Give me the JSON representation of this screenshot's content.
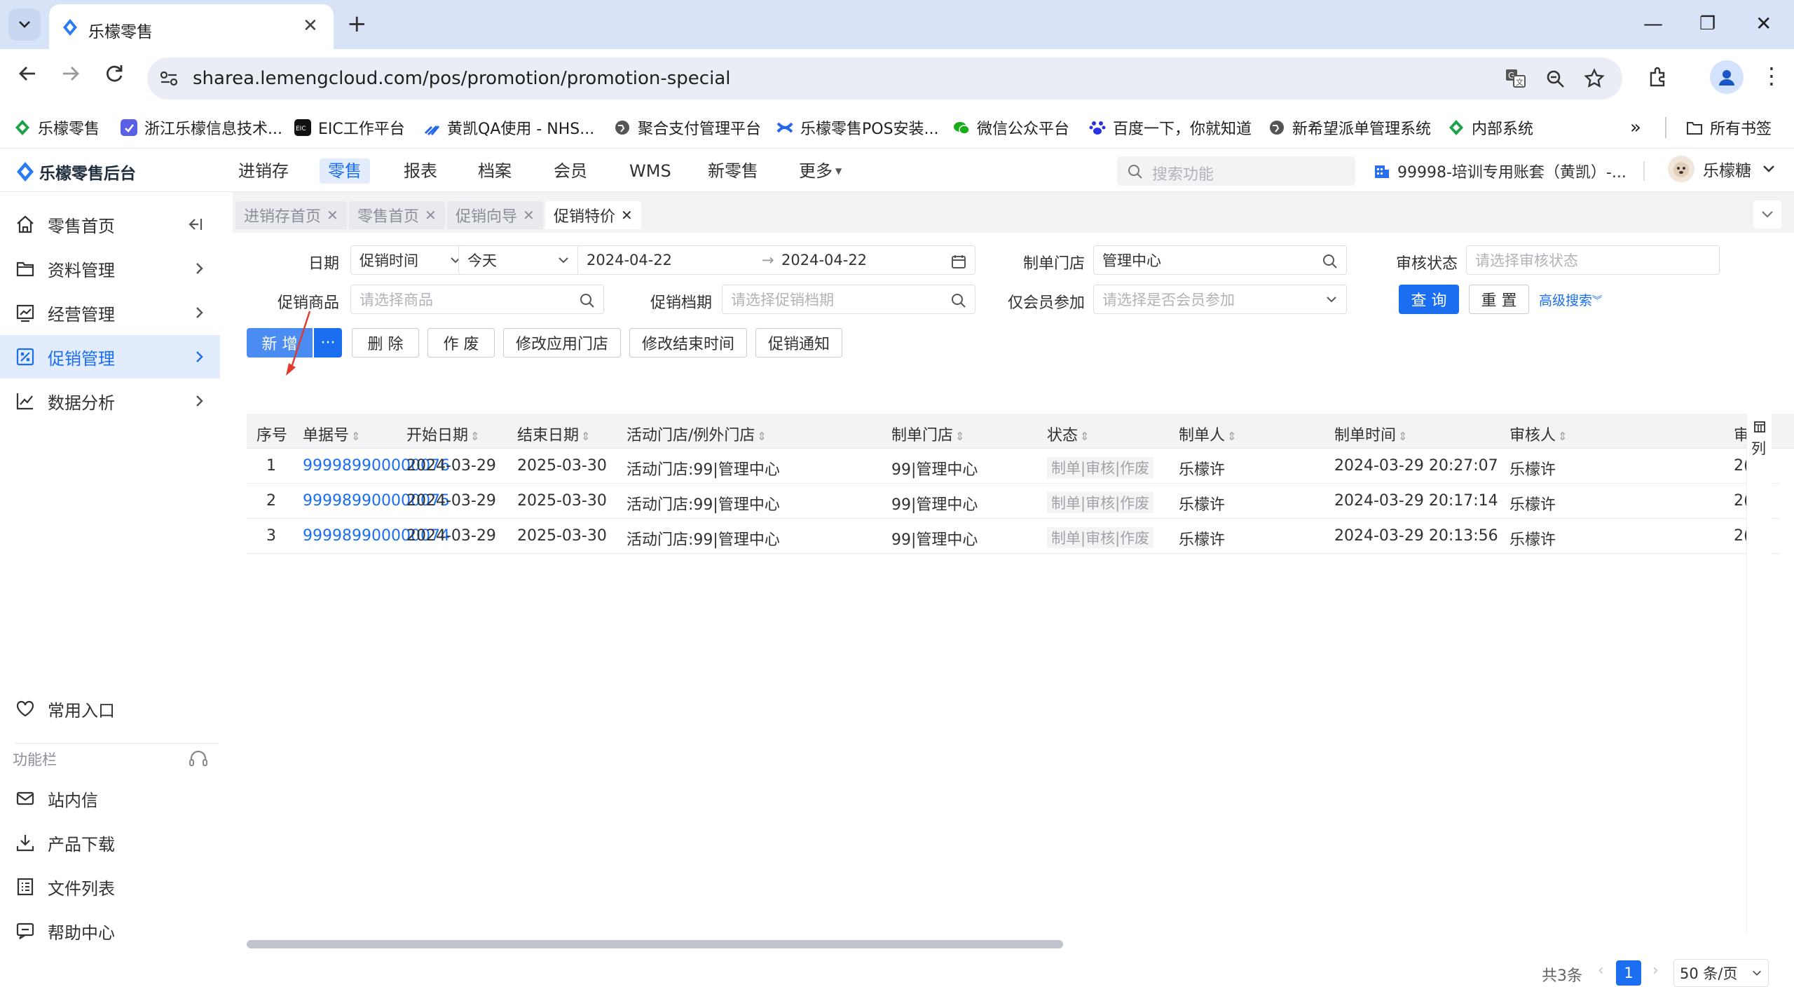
{
  "browser": {
    "tab_title": "乐檬零售",
    "url": "sharea.lemengcloud.com/pos/promotion/promotion-special",
    "bookmarks": [
      "乐檬零售",
      "浙江乐檬信息技术...",
      "EIC工作平台",
      "黄凯QA使用 - NHS...",
      "聚合支付管理平台",
      "乐檬零售POS安装...",
      "微信公众平台",
      "百度一下，你就知道",
      "新希望派单管理系统",
      "内部系统"
    ],
    "all_bookmarks": "所有书签"
  },
  "app": {
    "brand": "乐檬零售后台",
    "nav": [
      "进销存",
      "零售",
      "报表",
      "档案",
      "会员",
      "WMS",
      "新零售",
      "更多"
    ],
    "active_nav": "零售",
    "search_placeholder": "搜索功能",
    "account": "99998-培训专用账套（黄凯）-...",
    "user": "乐檬糖"
  },
  "sidebar": {
    "items": [
      {
        "label": "零售首页",
        "icon": "home-icon"
      },
      {
        "label": "资料管理",
        "icon": "folder-icon"
      },
      {
        "label": "经营管理",
        "icon": "chart-board-icon"
      },
      {
        "label": "促销管理",
        "icon": "promotion-icon"
      },
      {
        "label": "数据分析",
        "icon": "line-chart-icon"
      }
    ],
    "common_entry": "常用入口",
    "func_bar": "功能栏",
    "bottom": [
      "站内信",
      "产品下载",
      "文件列表",
      "帮助中心"
    ]
  },
  "page_tabs": [
    "进销存首页",
    "零售首页",
    "促销向导",
    "促销特价"
  ],
  "filters": {
    "date_label": "日期",
    "date_type": "促销时间",
    "date_range_type": "今天",
    "date_start": "2024-04-22",
    "date_end": "2024-04-22",
    "store_label": "制单门店",
    "store_value": "管理中心",
    "audit_label": "审核状态",
    "audit_placeholder": "请选择审核状态",
    "product_label": "促销商品",
    "product_placeholder": "请选择商品",
    "level_label": "促销档期",
    "level_placeholder": "请选择促销档期",
    "member_label": "仅会员参加",
    "member_placeholder": "请选择是否会员参加",
    "query": "查 询",
    "reset": "重 置",
    "advanced": "高级搜索"
  },
  "actions": {
    "add": "新 增",
    "more": "···",
    "delete": "删 除",
    "void": "作 废",
    "modify_store": "修改应用门店",
    "modify_end": "修改结束时间",
    "notify": "促销通知"
  },
  "table": {
    "columns": [
      "序号",
      "单据号",
      "开始日期",
      "结束日期",
      "活动门店/例外门店",
      "制单门店",
      "状态",
      "制单人",
      "制单时间",
      "审核人",
      "审"
    ],
    "rows": [
      {
        "no": "1",
        "doc": "999989900000076",
        "start": "2024-03-29",
        "end": "2025-03-30",
        "stores": "活动门店:99|管理中心",
        "maker_store": "99|管理中心",
        "status": "制单|审核|作废",
        "maker": "乐檬许",
        "time": "2024-03-29 20:27:07",
        "auditor": "乐檬许",
        "extra": "2("
      },
      {
        "no": "2",
        "doc": "999989900000075",
        "start": "2024-03-29",
        "end": "2025-03-30",
        "stores": "活动门店:99|管理中心",
        "maker_store": "99|管理中心",
        "status": "制单|审核|作废",
        "maker": "乐檬许",
        "time": "2024-03-29 20:17:14",
        "auditor": "乐檬许",
        "extra": "2("
      },
      {
        "no": "3",
        "doc": "999989900000074",
        "start": "2024-03-29",
        "end": "2025-03-30",
        "stores": "活动门店:99|管理中心",
        "maker_store": "99|管理中心",
        "status": "制单|审核|作废",
        "maker": "乐檬许",
        "time": "2024-03-29 20:13:56",
        "auditor": "乐檬许",
        "extra": "2("
      }
    ],
    "col_setting": "列"
  },
  "pagination": {
    "total": "共3条",
    "page": "1",
    "size": "50 条/页"
  },
  "colors": {
    "primary": "#1a6eef",
    "bg": "#f2f3f5"
  }
}
